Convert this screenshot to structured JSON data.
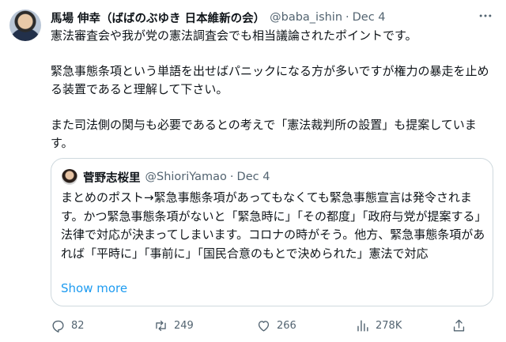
{
  "tweet": {
    "author_name": "馬場 伸幸（ばばのぶゆき 日本維新の会）",
    "handle": "@baba_ishin",
    "separator": "·",
    "date": "Dec 4",
    "paragraphs": [
      "憲法審査会や我が党の憲法調査会でも相当議論されたポイントです。",
      "緊急事態条項という単語を出せばパニックになる方が多いですが権力の暴走を止める装置であると理解して下さい。",
      "また司法側の関与も必要であるとの考えで「憲法裁判所の設置」も提案しています。"
    ]
  },
  "quoted": {
    "author_name": "菅野志桜里",
    "handle": "@ShioriYamao",
    "separator": "·",
    "date": "Dec 4",
    "text": "まとめのポスト→緊急事態条項があってもなくても緊急事態宣言は発令されます。かつ緊急事態条項がないと「緊急時に」「その都度」「政府与党が提案する」法律で対応が決まってしまいます。コロナの時がそう。他方、緊急事態条項があれば「平時に」「事前に」「国民合意のもとで決められた」憲法で対応",
    "show_more": "Show more"
  },
  "actions": {
    "replies": "82",
    "reposts": "249",
    "likes": "266",
    "views": "278K"
  },
  "icons": [
    "more-icon",
    "reply-icon",
    "repost-icon",
    "like-icon",
    "views-icon",
    "share-icon"
  ],
  "colors": {
    "link": "#1d9bf0",
    "secondary_text": "#536471",
    "border": "#cfd9de"
  }
}
